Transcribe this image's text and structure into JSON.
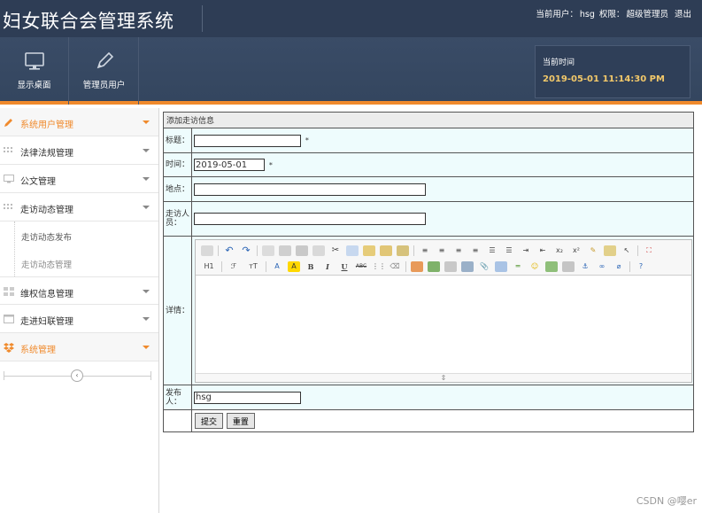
{
  "header": {
    "title": "妇女联合会管理系统",
    "user_prefix": "当前用户：",
    "user_name": "hsg",
    "role_prefix": "权限：",
    "role_name": "超级管理员",
    "logout": "退出",
    "nav": [
      {
        "label": "显示桌面",
        "icon": "monitor-icon"
      },
      {
        "label": "管理员用户",
        "icon": "pencil-icon"
      }
    ],
    "time_label": "当前时间",
    "time_value": "2019-05-01 11:14:30 PM"
  },
  "sidebar": {
    "items": [
      {
        "label": "系统用户管理",
        "icon": "pencil-icon",
        "active": true
      },
      {
        "label": "法律法规管理",
        "icon": "grid-icon"
      },
      {
        "label": "公文管理",
        "icon": "monitor-icon"
      },
      {
        "label": "走访动态管理",
        "icon": "grid-icon"
      },
      {
        "label": "维权信息管理",
        "icon": "grid-icon"
      },
      {
        "label": "走进妇联管理",
        "icon": "calendar-icon"
      },
      {
        "label": "系统管理",
        "icon": "dropbox-icon",
        "active": true
      }
    ],
    "subitems": [
      {
        "label": "走访动态发布"
      },
      {
        "label": "走访动态管理"
      }
    ],
    "collapse_icon": "chevron-left-icon"
  },
  "form": {
    "caption": "添加走访信息",
    "fields": {
      "title_label": "标题：",
      "title_value": "",
      "title_required": "*",
      "time_label": "时间：",
      "time_value": "2019-05-01",
      "time_required": "*",
      "place_label": "地点：",
      "place_value": "",
      "visitor_label": "走访人员：",
      "visitor_value": "",
      "detail_label": "详情：",
      "publisher_label": "发布人：",
      "publisher_value": "hsg"
    },
    "submit_label": "提交",
    "reset_label": "重置"
  },
  "editor": {
    "toolbar_row1": [
      "source-icon",
      "undo-icon",
      "redo-icon",
      "preview-icon",
      "print-icon",
      "template-icon",
      "code-icon",
      "cut-icon",
      "copy-icon",
      "paste-icon",
      "paste-text-icon",
      "paste-word-icon",
      "align-left-icon",
      "align-center-icon",
      "align-right-icon",
      "justify-icon",
      "ordered-list-icon",
      "unordered-list-icon",
      "indent-icon",
      "outdent-icon",
      "subscript-icon",
      "superscript-icon",
      "clear-format-icon",
      "quick-format-icon",
      "select-all-icon",
      "fullscreen-icon"
    ],
    "toolbar_row2": [
      "heading-icon",
      "font-family-icon",
      "font-size-icon",
      "font-color-icon",
      "highlight-icon",
      "bold-icon",
      "italic-icon",
      "underline-icon",
      "strikethrough-icon",
      "line-height-icon",
      "remove-format-icon",
      "image-icon",
      "multi-image-icon",
      "flash-icon",
      "media-icon",
      "attachment-icon",
      "table-icon",
      "hr-icon",
      "emoticon-icon",
      "map-icon",
      "page-break-icon",
      "anchor-icon",
      "link-icon",
      "unlink-icon",
      "help-icon"
    ],
    "row2_text": {
      "heading": "H1",
      "font": "ℱ",
      "size": "тT",
      "color": "A",
      "highlight": "A",
      "bold": "B",
      "italic": "I",
      "underline": "U",
      "strike": "ABC"
    }
  },
  "watermark": "CSDN @嘤er"
}
